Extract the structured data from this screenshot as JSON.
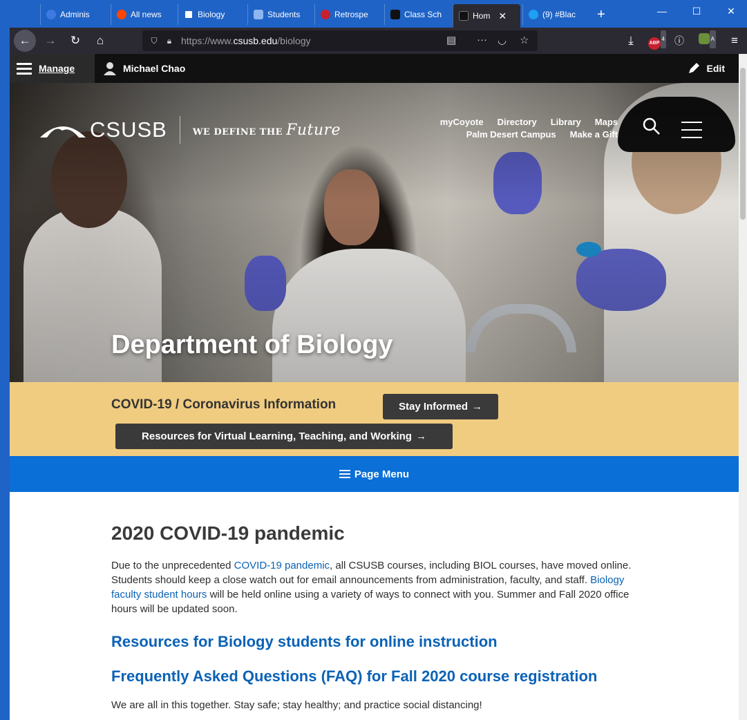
{
  "browser": {
    "tabs": [
      {
        "label": "Adminis",
        "color": "#1f63c6"
      },
      {
        "label": "All news",
        "color": "#ff4500"
      },
      {
        "label": "Biology",
        "color": "#ffffff"
      },
      {
        "label": "Students",
        "color": "#2b6cd8"
      },
      {
        "label": "Retrospe",
        "color": "#c8202e"
      },
      {
        "label": "Class Sch",
        "color": "#111111"
      },
      {
        "label": "Hom",
        "color": "#111111"
      },
      {
        "label": "(9) #Blac",
        "color": "#1da1f2"
      }
    ],
    "new_tab": "+",
    "url_prefix": "https://www.",
    "url_domain": "csusb.edu",
    "url_path": "/biology",
    "abp_count": "4",
    "ext_letter": "A"
  },
  "admin": {
    "manage": "Manage",
    "user": "Michael Chao",
    "edit": "Edit"
  },
  "header": {
    "logo": "CSUSB",
    "tagline": "WE DEFINE THE",
    "tagline_script": "Future",
    "links_row1": [
      "myCoyote",
      "Directory",
      "Library",
      "Maps"
    ],
    "links_row2": [
      "Palm Desert Campus",
      "Make a Gift"
    ]
  },
  "hero": {
    "title": "Department of Biology"
  },
  "covid": {
    "title": "COVID-19 / Coronavirus Information",
    "stay_informed": "Stay Informed",
    "resources": "Resources for Virtual Learning, Teaching, and Working"
  },
  "page_menu": "Page Menu",
  "content": {
    "heading": "2020 COVID-19 pandemic",
    "p1_a": "Due to the unprecedented ",
    "p1_link1": "COVID-19 pandemic",
    "p1_b": ", all CSUSB courses, including BIOL courses, have moved online. Students should keep a close watch out for email announcements from administration, faculty, and staff. ",
    "p1_link2": "Biology faculty student hours",
    "p1_c": " will be held online using a variety of ways to connect with you. Summer and Fall 2020 office hours will be updated soon.",
    "h2_resources": "Resources for Biology students for online instruction",
    "h2_faq": "Frequently Asked Questions (FAQ) for Fall 2020 course registration",
    "tail": "We are all in this together. Stay safe; stay healthy; and practice social distancing!"
  }
}
